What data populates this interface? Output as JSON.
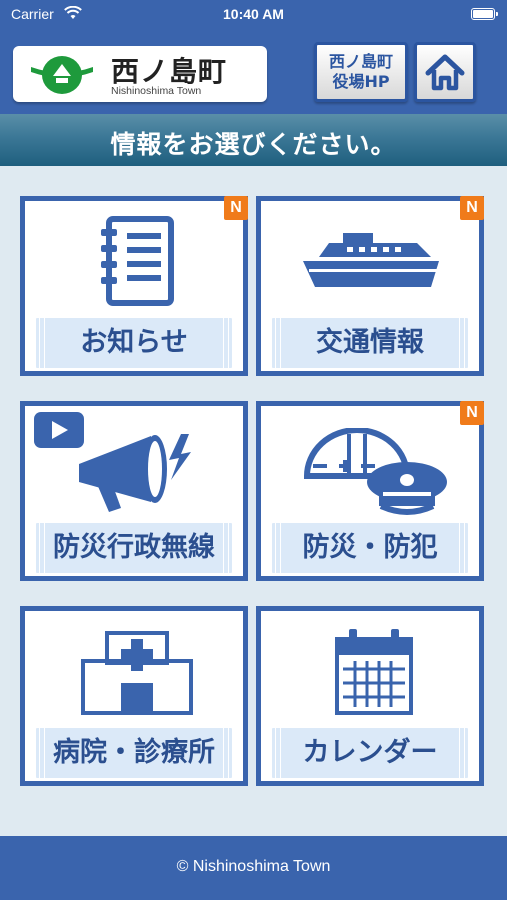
{
  "status_bar": {
    "carrier": "Carrier",
    "time": "10:40 AM",
    "wifi_icon": "wifi-icon",
    "battery_icon": "battery-icon"
  },
  "header": {
    "logo": {
      "name": "西ノ島町",
      "sub": "Nishinoshima Town",
      "emblem_icon": "town-emblem-icon"
    },
    "hp_button": {
      "line1": "西ノ島町",
      "line2": "役場HP"
    },
    "home_icon": "home-icon"
  },
  "prompt": "情報をお選びください。",
  "menu": {
    "badge_new": "N",
    "items": [
      {
        "label": "お知らせ",
        "icon": "notebook-icon",
        "new": true
      },
      {
        "label": "交通情報",
        "icon": "ferry-icon",
        "new": true
      },
      {
        "label": "防災行政無線",
        "icon": "megaphone-icon",
        "new": false,
        "video_badge": true
      },
      {
        "label": "防災・防犯",
        "icon": "helmet-cap-icon",
        "new": true
      },
      {
        "label": "病院・診療所",
        "icon": "hospital-icon",
        "new": false
      },
      {
        "label": "カレンダー",
        "icon": "calendar-icon",
        "new": false
      }
    ]
  },
  "footer": {
    "copyright": "© Nishinoshima Town"
  },
  "colors": {
    "primary_blue": "#3a64ad",
    "background": "#dfeaf1",
    "label_bg": "#dbe9f8",
    "badge_orange": "#f07b1a",
    "emblem_green": "#1e9a3c"
  }
}
